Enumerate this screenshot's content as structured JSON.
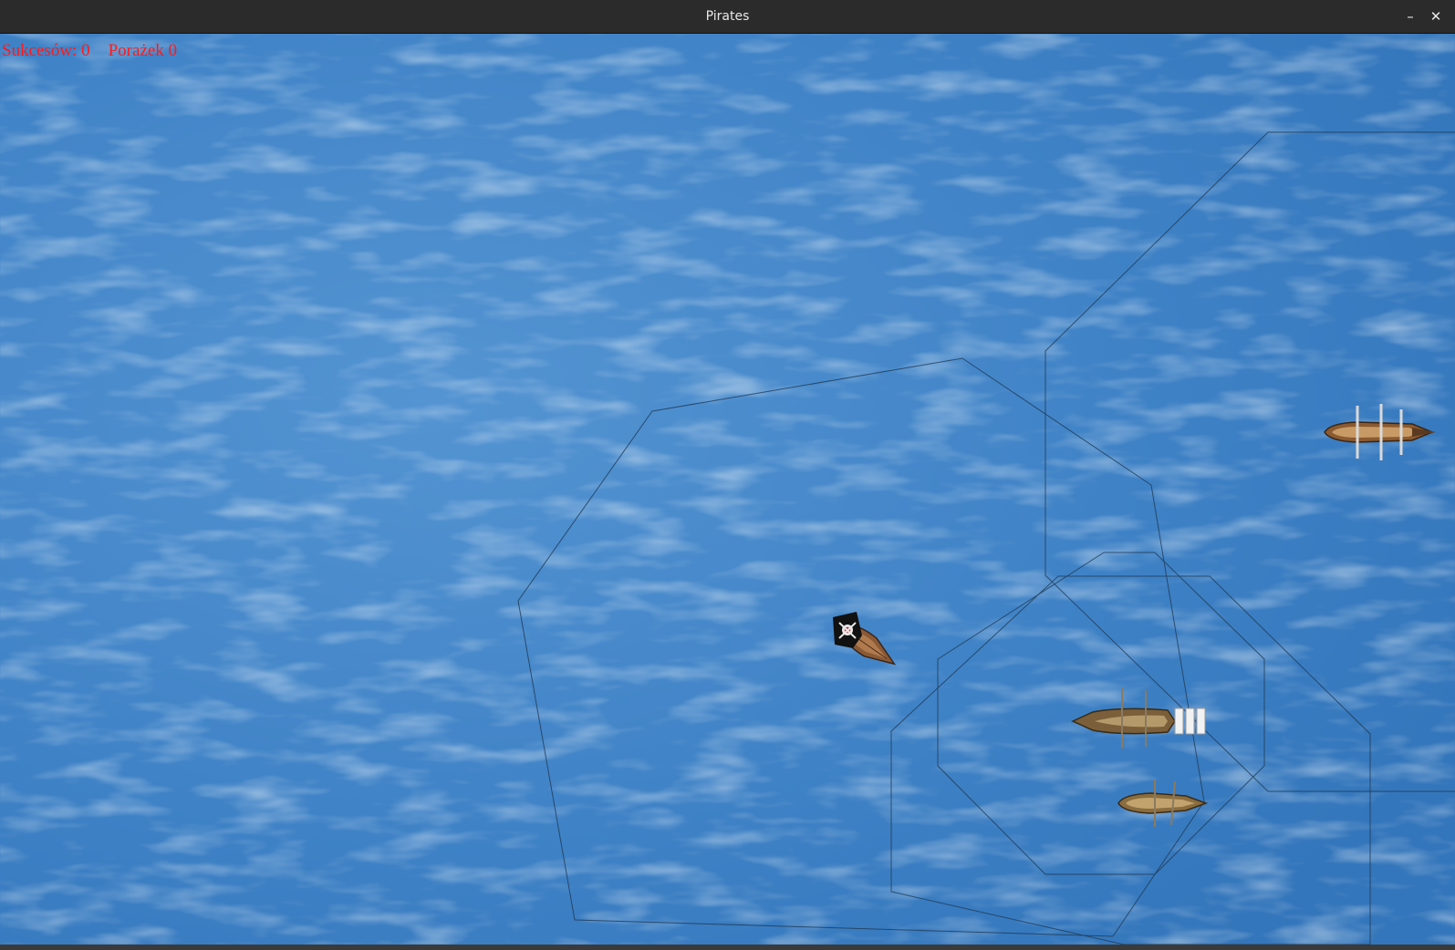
{
  "window": {
    "title": "Pirates",
    "minimize_icon": "minimize-icon",
    "close_icon": "close-icon",
    "minimize_glyph": "–",
    "close_glyph": "✕"
  },
  "hud": {
    "successes_label": "Sukcesów: 0",
    "failures_label": "Porażek 0"
  },
  "scene": {
    "background": "sea-texture",
    "sea_color": "#3f82c6",
    "sensor_line_color": "#1f3a55",
    "ships": [
      {
        "name": "pirate-ship",
        "flag": "jolly-roger"
      },
      {
        "name": "merchant-ship-east"
      },
      {
        "name": "galleon-south"
      },
      {
        "name": "small-boat-south"
      }
    ]
  }
}
